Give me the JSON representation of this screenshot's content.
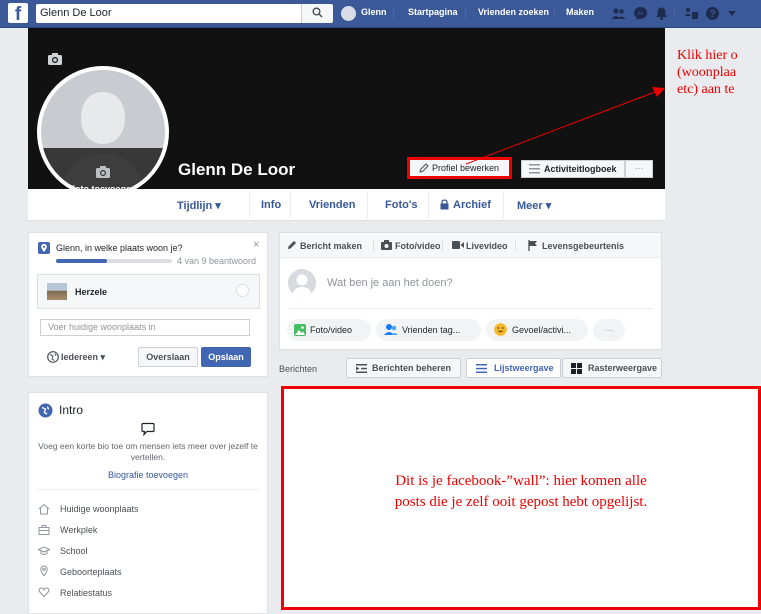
{
  "topbar": {
    "search_value": "Glenn De Loor",
    "user_name": "Glenn",
    "nav": [
      "Startpagina",
      "Vrienden zoeken",
      "Maken"
    ]
  },
  "profile": {
    "name": "Glenn De Loor",
    "add_photo": "Foto toevoegen",
    "edit_profile": "Profiel bewerken",
    "activity_log": "Activiteitlogboek",
    "more": "···"
  },
  "tabs": [
    "Tijdlijn ▾",
    "Info",
    "Vrienden",
    "Foto's",
    "Archief",
    "Meer ▾"
  ],
  "annotation_top": {
    "lines": [
      "Klik hier o",
      "(woonplaa",
      "etc) aan te"
    ]
  },
  "question_card": {
    "question": "Glenn, in welke plaats woon je?",
    "progress_text": "4 van 9 beantwoord",
    "progress": 0.44,
    "place_name": "Herzele",
    "input_placeholder": "Voer huidige woonplaats in",
    "audience": "Iedereen",
    "skip": "Overslaan",
    "save": "Opslaan"
  },
  "intro": {
    "title": "Intro",
    "bio_prompt": "Voeg een korte bio toe om mensen iets meer over jezelf te vertellen.",
    "bio_link": "Biografie toevoegen",
    "items": [
      "Huidige woonplaats",
      "Werkplek",
      "School",
      "Geboorteplaats",
      "Relatiestatus"
    ]
  },
  "composer": {
    "tabs": [
      "Bericht maken",
      "Foto/video",
      "Livevideo",
      "Levensgebeurtenis"
    ],
    "placeholder": "Wat ben je aan het doen?",
    "actions": [
      "Foto/video",
      "Vrienden tag...",
      "Gevoel/activi...",
      "···"
    ]
  },
  "posts_bar": {
    "label": "Berichten",
    "manage": "Berichten beheren",
    "list_view": "Lijstweergave",
    "grid_view": "Rasterweergave"
  },
  "wall_annotation": {
    "line1": "Dit is je facebook-”wall”: hier komen alle",
    "line2": "posts die je zelf ooit gepost hebt opgelijst."
  },
  "colors": {
    "brand": "#3b5998",
    "annotation": "#ee0000",
    "primary_button": "#4267b2"
  }
}
